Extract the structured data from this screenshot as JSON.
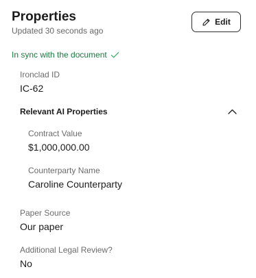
{
  "header": {
    "title": "Properties",
    "updated": "Updated 30 seconds ago",
    "edit_label": "Edit"
  },
  "sync": {
    "text": "In sync with the document",
    "color": "#167a3e"
  },
  "fields": {
    "ironclad_id": {
      "label": "Ironclad ID",
      "value": "IC-62"
    },
    "relevant_ai": {
      "title": "Relevant AI Properties",
      "expanded": true,
      "contract_value": {
        "label": "Contract Value",
        "value": "$1,000,000.00"
      },
      "counterparty_name": {
        "label": "Counterparty Name",
        "value": "Caroline Counterparty"
      }
    },
    "paper_source": {
      "label": "Paper Source",
      "value": "Our paper"
    },
    "additional_legal_review": {
      "label": "Additional Legal Review?",
      "value": "No"
    }
  },
  "icons": {
    "edit": "pencil-icon",
    "sync": "checkmark-icon",
    "collapse": "chevron-up-icon"
  }
}
